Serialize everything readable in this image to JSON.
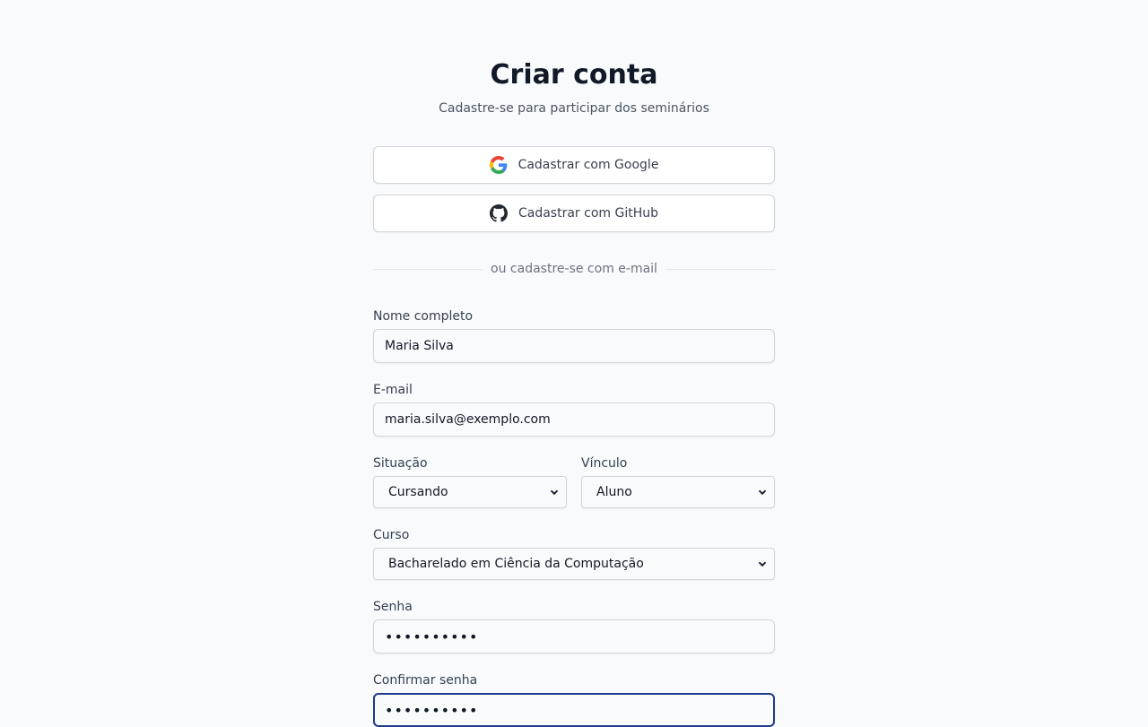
{
  "header": {
    "title": "Criar conta",
    "subtitle": "Cadastre-se para participar dos seminários"
  },
  "oauth": {
    "google_label": "Cadastrar com Google",
    "github_label": "Cadastrar com GitHub"
  },
  "divider_text": "ou cadastre-se com e-mail",
  "form": {
    "name": {
      "label": "Nome completo",
      "value": "Maria Silva"
    },
    "email": {
      "label": "E-mail",
      "value": "maria.silva@exemplo.com"
    },
    "situacao": {
      "label": "Situação",
      "selected": "Cursando"
    },
    "vinculo": {
      "label": "Vínculo",
      "selected": "Aluno"
    },
    "curso": {
      "label": "Curso",
      "selected": "Bacharelado em Ciência da Computação"
    },
    "senha": {
      "label": "Senha",
      "value": "••••••••••"
    },
    "confirmar": {
      "label": "Confirmar senha",
      "value": "••••••••••"
    }
  },
  "colors": {
    "focus_border": "#1e3a8a",
    "background": "#f8fafc"
  }
}
